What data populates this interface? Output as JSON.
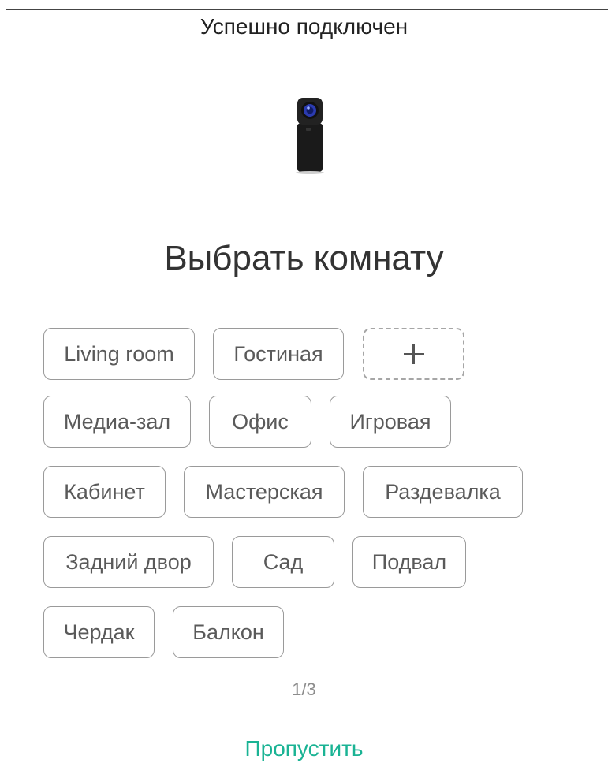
{
  "header": {
    "title": "Успешно подключен"
  },
  "device": {
    "icon": "camera-device-icon"
  },
  "room_picker": {
    "title": "Выбрать комнату",
    "rooms": [
      "Living room",
      "Гостиная",
      "Медиа-зал",
      "Офис",
      "Игровая",
      "Кабинет",
      "Мастерская",
      "Раздевалка",
      "Задний двор",
      "Сад",
      "Подвал",
      "Чердак",
      "Балкон"
    ],
    "add_icon": "plus-icon",
    "pager": "1/3"
  },
  "footer": {
    "skip_label": "Пропустить"
  },
  "colors": {
    "accent": "#1ab394",
    "chip_border": "#9a9a9a",
    "chip_text": "#5a5a5a"
  }
}
